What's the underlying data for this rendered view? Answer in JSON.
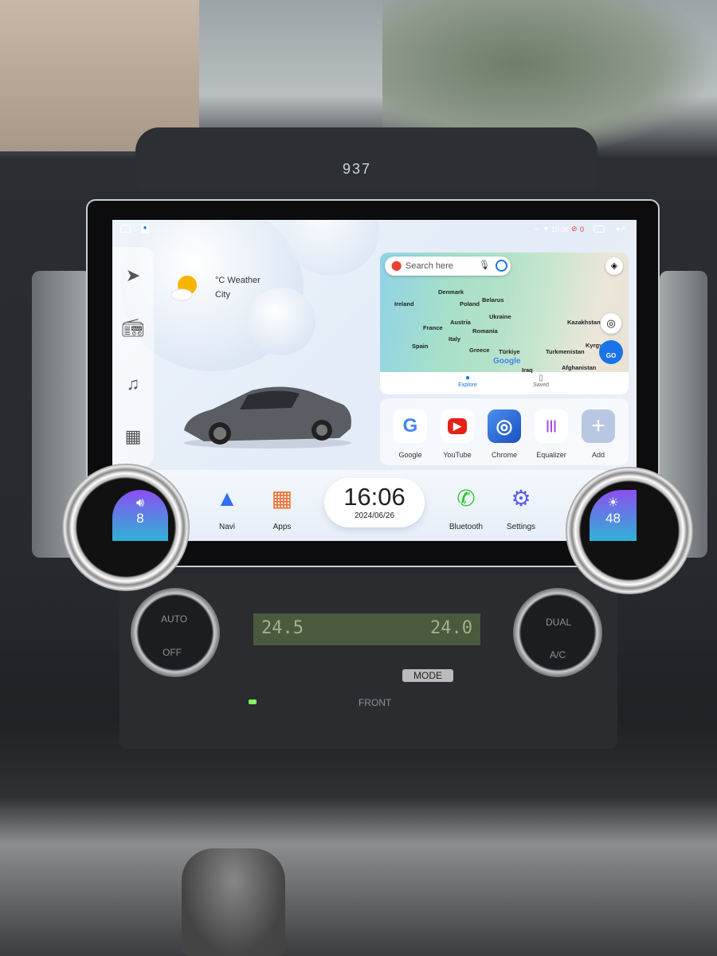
{
  "dashboard": {
    "odometer": "937",
    "hvac_left": [
      "AUTO",
      "OFF"
    ],
    "hvac_right": [
      "DUAL",
      "A/C"
    ],
    "lcd_left": "24.5",
    "lcd_right": "24.0",
    "mode_label": "MODE",
    "front_label": "FRONT"
  },
  "status_bar": {
    "time": "16:06",
    "alert_count": "0",
    "icons": [
      "home-icon",
      "maps-app-icon",
      "bluetooth-icon",
      "wifi-icon",
      "mute-icon",
      "recent-apps-icon",
      "back-icon"
    ]
  },
  "dock": {
    "items": [
      "navigation-icon",
      "radio-icon",
      "music-icon",
      "apps-grid-icon"
    ]
  },
  "weather": {
    "temp": "°C Weather",
    "city": "City",
    "icon": "partly-sunny-icon"
  },
  "map": {
    "search_placeholder": "Search here",
    "labels": [
      "Denmark",
      "Ireland",
      "Poland",
      "Belarus",
      "Ukraine",
      "France",
      "Austria",
      "Romania",
      "Kazakhstan",
      "Italy",
      "Spain",
      "Greece",
      "Türkiye",
      "Turkmenistan",
      "Kyrgyz",
      "Iraq",
      "Afghanistan"
    ],
    "brand": "Google",
    "go": "GO",
    "tabs": [
      {
        "label": "Explore",
        "active": true
      },
      {
        "label": "Saved",
        "active": false
      }
    ]
  },
  "apps": [
    {
      "label": "Google",
      "glyph": "G",
      "color": "#4285f4"
    },
    {
      "label": "YouTube",
      "glyph": "▶",
      "color": "#e62117"
    },
    {
      "label": "Chrome",
      "glyph": "◎",
      "color": "#1a73e8"
    },
    {
      "label": "Equalizer",
      "glyph": "|||",
      "color": "#a04ee8"
    },
    {
      "label": "Add",
      "glyph": "+",
      "color": "#ffffff"
    }
  ],
  "bottom": {
    "volume": "8",
    "brightness": "48",
    "clock_time": "16:06",
    "clock_date": "2024/06/26",
    "buttons": [
      {
        "label": "Navi"
      },
      {
        "label": "Apps"
      },
      {
        "label": "Bluetooth"
      },
      {
        "label": "Settings"
      }
    ]
  },
  "colors": {
    "accent": "#1a73e8",
    "knob_gradient_top": "#8a4ff0",
    "knob_gradient_bottom": "#2fb3d6",
    "alert": "#e53935"
  }
}
